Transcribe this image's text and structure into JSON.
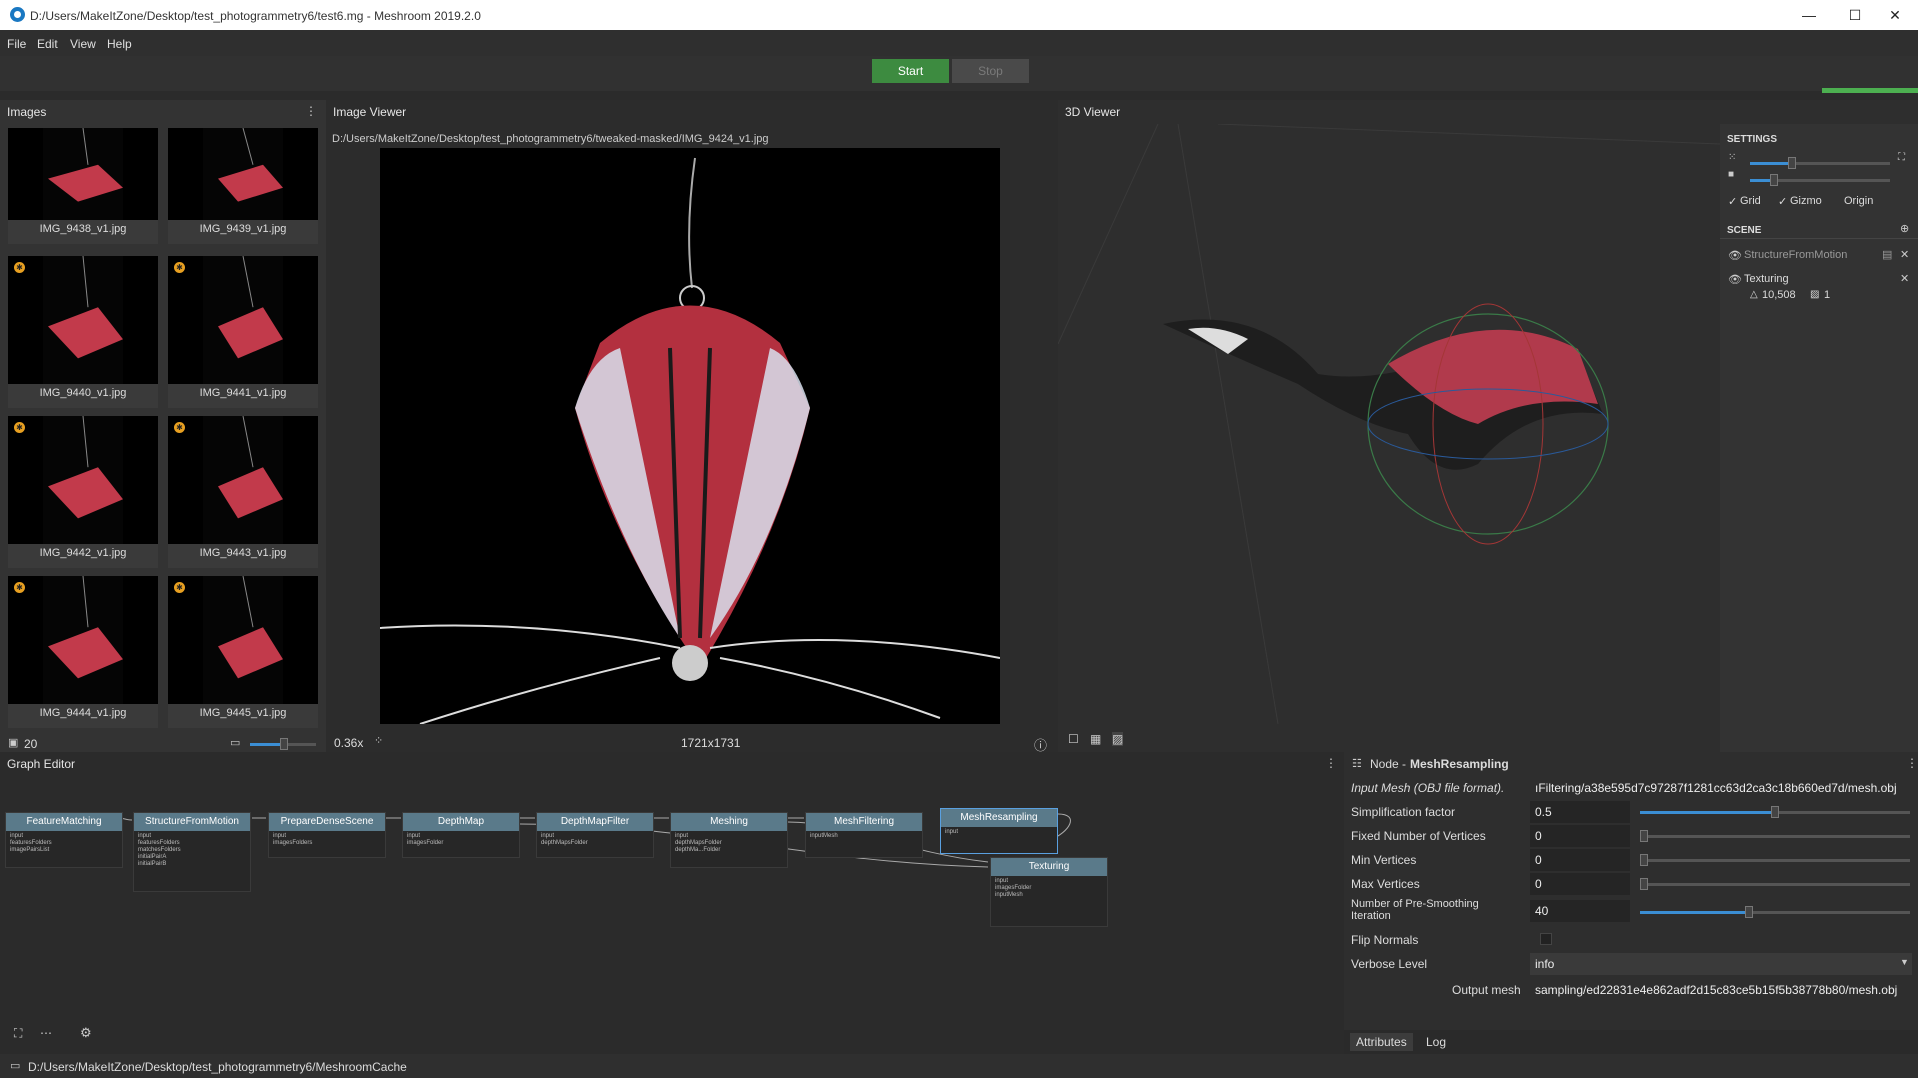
{
  "window": {
    "title": "D:/Users/MakeItZone/Desktop/test_photogrammetry6/test6.mg - Meshroom 2019.2.0",
    "minimize": "—",
    "maximize": "☐",
    "close": "✕"
  },
  "menu": {
    "items": [
      "File",
      "Edit",
      "View",
      "Help"
    ]
  },
  "toolbar": {
    "start_label": "Start",
    "stop_label": "Stop",
    "progress": 1.0,
    "progress_color": "#4caf50"
  },
  "images": {
    "title": "Images",
    "count": "20",
    "thumbs": [
      {
        "label": "IMG_9438_v1.jpg",
        "badge": false
      },
      {
        "label": "IMG_9439_v1.jpg",
        "badge": false
      },
      {
        "label": "IMG_9440_v1.jpg",
        "badge": true
      },
      {
        "label": "IMG_9441_v1.jpg",
        "badge": true
      },
      {
        "label": "IMG_9442_v1.jpg",
        "badge": true
      },
      {
        "label": "IMG_9443_v1.jpg",
        "badge": true
      },
      {
        "label": "IMG_9444_v1.jpg",
        "badge": true
      },
      {
        "label": "IMG_9445_v1.jpg",
        "badge": true
      }
    ]
  },
  "viewer": {
    "title": "Image Viewer",
    "path": "D:/Users/MakeItZone/Desktop/test_photogrammetry6/tweaked-masked/IMG_9424_v1.jpg",
    "zoom": "0.36x",
    "resolution": "1721x1731"
  },
  "viewer3d": {
    "title": "3D Viewer",
    "settings_title": "SETTINGS",
    "grid": "Grid",
    "gizmo": "Gizmo",
    "origin": "Origin",
    "scene_title": "SCENE",
    "scene_items": [
      {
        "name": "StructureFromMotion",
        "dim": true
      },
      {
        "name": "Texturing",
        "dim": false
      }
    ],
    "triangles": "10,508",
    "textures": "1"
  },
  "graph": {
    "title": "Graph Editor",
    "nodes": [
      "FeatureMatching",
      "StructureFromMotion",
      "PrepareDenseScene",
      "DepthMap",
      "DepthMapFilter",
      "Meshing",
      "MeshFiltering",
      "MeshResampling",
      "Texturing"
    ]
  },
  "node_panel": {
    "prefix": "Node - ",
    "node_name": "MeshResampling",
    "attrs": [
      {
        "name": "Input Mesh (OBJ file format).",
        "value": "ıFiltering/a38e595d7c97287f1281cc63d2ca3c18b660ed7d/mesh.obj"
      },
      {
        "name": "Simplification factor",
        "value": "0.5"
      },
      {
        "name": "Fixed Number of Vertices",
        "value": "0"
      },
      {
        "name": "Min Vertices",
        "value": "0"
      },
      {
        "name": "Max Vertices",
        "value": "0"
      },
      {
        "name": "Number of Pre-Smoothing Iteration",
        "value": "40"
      },
      {
        "name": "Flip Normals",
        "value": ""
      },
      {
        "name": "Verbose Level",
        "value": "info"
      },
      {
        "name": "Output mesh",
        "value": "sampling/ed22831e4e862adf2d15c83ce5b15f5b38778b80/mesh.obj"
      }
    ],
    "tab_attributes": "Attributes",
    "tab_log": "Log"
  },
  "status": {
    "path": "D:/Users/MakeItZone/Desktop/test_photogrammetry6/MeshroomCache"
  }
}
